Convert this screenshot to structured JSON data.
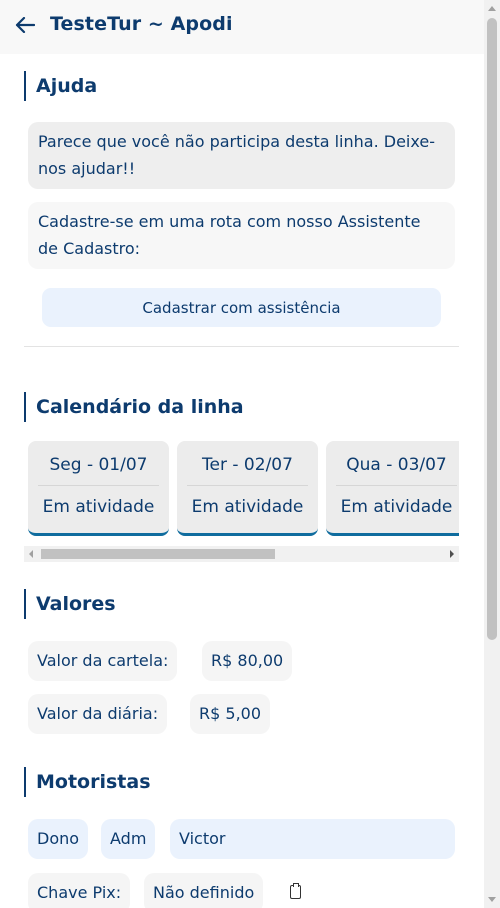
{
  "header": {
    "title": "TesteTur ~ Apodi",
    "back_icon": "arrow-left-icon"
  },
  "help": {
    "title": "Ajuda",
    "message1": "Parece que você não participa desta linha. Deixe-nos ajudar!!",
    "message2": "Cadastre-se em uma rota com nosso Assistente de Cadastro:",
    "assist_button": "Cadastrar com assistência"
  },
  "calendar": {
    "title": "Calendário da linha",
    "days": [
      {
        "date": "Seg - 01/07",
        "status": "Em atividade"
      },
      {
        "date": "Ter - 02/07",
        "status": "Em atividade"
      },
      {
        "date": "Qua - 03/07",
        "status": "Em atividade"
      }
    ]
  },
  "values": {
    "title": "Valores",
    "card_label": "Valor da cartela:",
    "card_value": "R$ 80,00",
    "daily_label": "Valor da diária:",
    "daily_value": "R$ 5,00"
  },
  "drivers": {
    "title": "Motoristas",
    "tags": [
      "Dono",
      "Adm"
    ],
    "name": "Victor",
    "pix_label": "Chave Pix:",
    "pix_value": "Não definido",
    "copy_icon": "clipboard-icon"
  },
  "colors": {
    "primary": "#0d3b6e",
    "accent": "#0f6c9e",
    "chip_blue": "#eaf2fd"
  }
}
